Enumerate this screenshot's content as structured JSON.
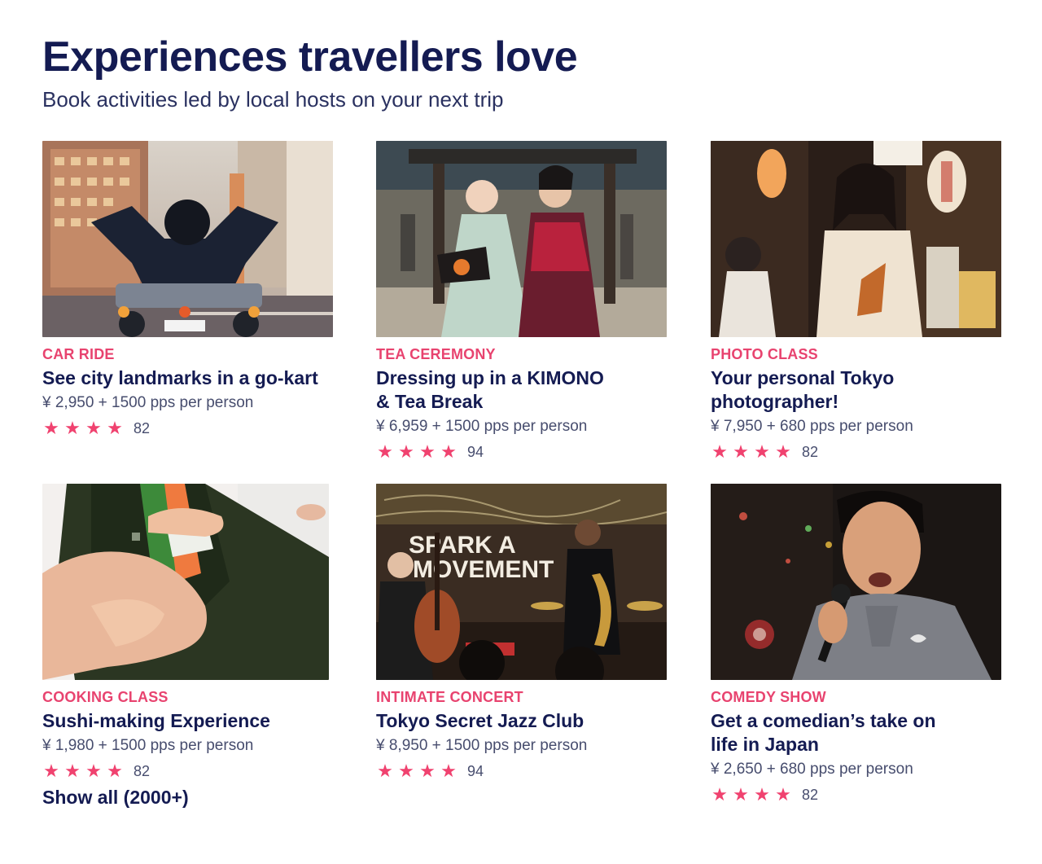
{
  "header": {
    "title": "Experiences travellers love",
    "subtitle": "Book activities led by local hosts on your next trip"
  },
  "accent_color": "#e8436f",
  "title_color": "#141b52",
  "star_icon": "star-icon",
  "cards": [
    {
      "category": "CAR RIDE",
      "title": "See city landmarks in a go-kart",
      "price": "¥ 2,950 + 1500 pps per person",
      "stars": 4,
      "reviews": "82",
      "image": "go-kart-city-street-photo"
    },
    {
      "category": "TEA CEREMONY",
      "title": "Dressing up in a KIMONO & Tea Break",
      "price": "¥ 6,959 + 1500 pps per person",
      "stars": 4,
      "reviews": "94",
      "image": "kimono-women-photo"
    },
    {
      "category": "PHOTO CLASS",
      "title": "Your personal Tokyo photographer!",
      "price": "¥ 7,950 + 680 pps per person",
      "stars": 4,
      "reviews": "82",
      "image": "tokyo-alley-portrait-photo"
    },
    {
      "category": "COOKING CLASS",
      "title": "Sushi-making Experience",
      "price": "¥ 1,980 + 1500 pps per person",
      "stars": 4,
      "reviews": "82",
      "image": "sushi-handroll-photo"
    },
    {
      "category": "INTIMATE CONCERT",
      "title": "Tokyo Secret Jazz Club",
      "price": "¥ 8,950 + 1500 pps per person",
      "stars": 4,
      "reviews": "94",
      "image": "jazz-club-photo",
      "sign_text": "SPARK A MOVEMENT"
    },
    {
      "category": "COMEDY SHOW",
      "title": "Get a comedian’s take on life in Japan",
      "price": "¥ 2,650 + 680 pps per person",
      "stars": 4,
      "reviews": "82",
      "image": "comedian-microphone-photo"
    }
  ],
  "show_all": "Show all (2000+)"
}
